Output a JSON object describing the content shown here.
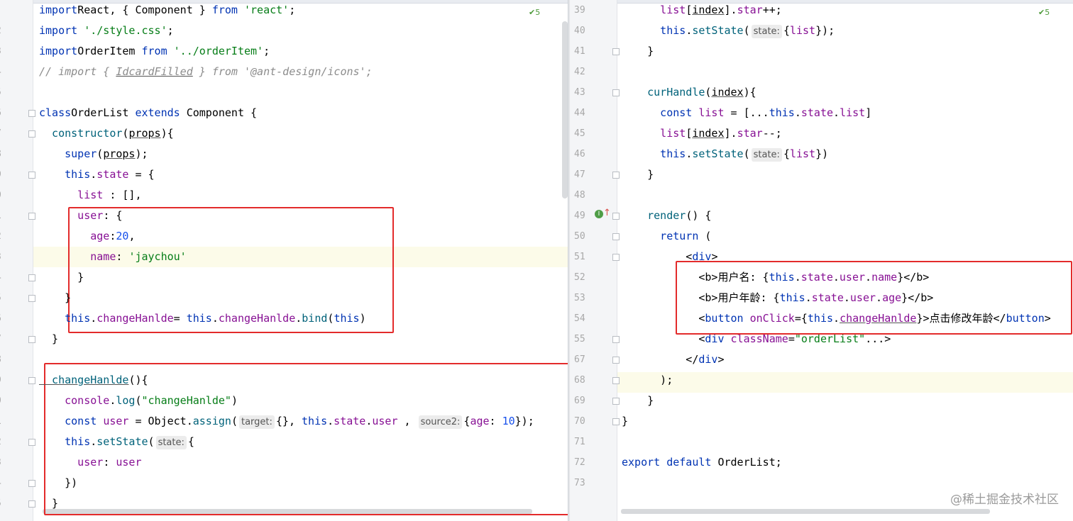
{
  "left_editor": {
    "inspection_badge": "5",
    "line_numbers": [
      "",
      "2",
      "3",
      "4",
      "5",
      "6",
      "7",
      "8",
      "9",
      "0",
      "1",
      "2",
      "3",
      "4",
      "5",
      "6",
      "7",
      "8",
      "9",
      "0",
      "1",
      "2",
      "3",
      "4",
      "5"
    ],
    "lines": [
      [
        [
          "kw",
          "import"
        ],
        [
          "",
          "React, { Component } "
        ],
        [
          "kw",
          "from"
        ],
        [
          "str",
          " 'react'"
        ],
        [
          "",
          ";"
        ]
      ],
      [
        [
          "kw",
          "import"
        ],
        [
          "str",
          " './style.css'"
        ],
        [
          "",
          ";"
        ]
      ],
      [
        [
          "kw",
          "import"
        ],
        [
          "",
          "OrderItem "
        ],
        [
          "kw",
          "from"
        ],
        [
          "str",
          " '../orderItem'"
        ],
        [
          "",
          ";"
        ]
      ],
      [
        [
          "cmt",
          "// import { "
        ],
        [
          "cmt-u",
          "IdcardFilled"
        ],
        [
          "cmt",
          " } from '@ant-design/icons';"
        ]
      ],
      [],
      [
        [
          "kw",
          "class"
        ],
        [
          "",
          "OrderList "
        ],
        [
          "kw",
          "extends"
        ],
        [
          "",
          " Component {"
        ]
      ],
      [
        [
          "",
          ""
        ],
        [
          "fn",
          "  constructor"
        ],
        [
          "",
          "("
        ],
        [
          "u",
          "props"
        ],
        [
          "",
          "){"
        ]
      ],
      [
        [
          "kw",
          "    super"
        ],
        [
          "",
          "("
        ],
        [
          "u",
          "props"
        ],
        [
          "",
          ");"
        ]
      ],
      [
        [
          "kw",
          "    this"
        ],
        [
          "",
          "."
        ],
        [
          "prop",
          "state"
        ],
        [
          "",
          " = {"
        ]
      ],
      [
        [
          "prop",
          "      list"
        ],
        [
          "",
          " : [],"
        ]
      ],
      [
        [
          "prop",
          "      user"
        ],
        [
          "",
          ": {"
        ]
      ],
      [
        [
          "prop",
          "        age"
        ],
        [
          "",
          ":"
        ],
        [
          "num",
          "20"
        ],
        [
          "",
          ","
        ]
      ],
      [
        [
          "prop",
          "        name"
        ],
        [
          "",
          ": "
        ],
        [
          "str",
          "'jaychou'"
        ]
      ],
      [
        [
          "",
          "      }"
        ]
      ],
      [
        [
          "",
          "    }"
        ]
      ],
      [
        [
          "kw",
          "    this"
        ],
        [
          "",
          "."
        ],
        [
          "prop",
          "changeHanlde"
        ],
        [
          "",
          "= "
        ],
        [
          "kw",
          "this"
        ],
        [
          "",
          "."
        ],
        [
          "prop",
          "changeHanlde"
        ],
        [
          "",
          "."
        ],
        [
          "fn",
          "bind"
        ],
        [
          "",
          "("
        ],
        [
          "kw",
          "this"
        ],
        [
          "",
          ")"
        ]
      ],
      [
        [
          "",
          "  }"
        ]
      ],
      [],
      [
        [
          "fn-u",
          "  changeHanlde"
        ],
        [
          "",
          "(){"
        ]
      ],
      [
        [
          "prop",
          "    console"
        ],
        [
          "",
          "."
        ],
        [
          "fn",
          "log"
        ],
        [
          "",
          "("
        ],
        [
          "str",
          "\"changeHanlde\""
        ],
        [
          "",
          ")"
        ]
      ],
      [
        [
          "kw",
          "    const "
        ],
        [
          "prop",
          "user"
        ],
        [
          "",
          " = "
        ],
        [
          "",
          "Object."
        ],
        [
          "fn",
          "assign"
        ],
        [
          "",
          "("
        ],
        [
          "hint",
          "target:"
        ],
        [
          "",
          "{}, "
        ],
        [
          "kw",
          "this"
        ],
        [
          "",
          "."
        ],
        [
          "prop",
          "state"
        ],
        [
          "",
          "."
        ],
        [
          "prop",
          "user"
        ],
        [
          "",
          " , "
        ],
        [
          "hint",
          "source2:"
        ],
        [
          "",
          "{"
        ],
        [
          "prop",
          "age"
        ],
        [
          "",
          ": "
        ],
        [
          "num",
          "10"
        ],
        [
          "",
          "});"
        ]
      ],
      [
        [
          "kw",
          "    this"
        ],
        [
          "",
          "."
        ],
        [
          "fn",
          "setState"
        ],
        [
          "",
          "("
        ],
        [
          "hint",
          "state:"
        ],
        [
          "",
          "{"
        ]
      ],
      [
        [
          "prop",
          "      user"
        ],
        [
          "",
          ": "
        ],
        [
          "prop",
          "user"
        ]
      ],
      [
        [
          "",
          "    })"
        ]
      ],
      [
        [
          "",
          "  }"
        ]
      ]
    ]
  },
  "right_editor": {
    "inspection_badge": "5",
    "line_numbers": [
      "39",
      "40",
      "41",
      "42",
      "43",
      "44",
      "45",
      "46",
      "47",
      "48",
      "49",
      "50",
      "51",
      "52",
      "53",
      "54",
      "55",
      "67",
      "68",
      "69",
      "70",
      "71",
      "72",
      "73"
    ],
    "lines": [
      [
        [
          "prop",
          "      list"
        ],
        [
          "",
          "["
        ],
        [
          "u",
          "index"
        ],
        [
          "",
          "]."
        ],
        [
          "prop",
          "star"
        ],
        [
          "",
          "++;"
        ]
      ],
      [
        [
          "kw",
          "      this"
        ],
        [
          "",
          "."
        ],
        [
          "fn",
          "setState"
        ],
        [
          "",
          "("
        ],
        [
          "hint",
          "state:"
        ],
        [
          "",
          "{"
        ],
        [
          "prop",
          "list"
        ],
        [
          "",
          "});"
        ]
      ],
      [
        [
          "",
          "    }"
        ]
      ],
      [],
      [
        [
          "fn",
          "    curHandle"
        ],
        [
          "",
          "("
        ],
        [
          "u",
          "index"
        ],
        [
          "",
          "){"
        ]
      ],
      [
        [
          "kw",
          "      const "
        ],
        [
          "prop",
          "list"
        ],
        [
          "",
          " = [..."
        ],
        [
          "kw",
          "this"
        ],
        [
          "",
          "."
        ],
        [
          "prop",
          "state"
        ],
        [
          "",
          "."
        ],
        [
          "prop",
          "list"
        ],
        [
          "",
          "]"
        ]
      ],
      [
        [
          "prop",
          "      list"
        ],
        [
          "",
          "["
        ],
        [
          "u",
          "index"
        ],
        [
          "",
          "]."
        ],
        [
          "prop",
          "star"
        ],
        [
          "",
          "--;"
        ]
      ],
      [
        [
          "kw",
          "      this"
        ],
        [
          "",
          "."
        ],
        [
          "fn",
          "setState"
        ],
        [
          "",
          "("
        ],
        [
          "hint",
          "state:"
        ],
        [
          "",
          "{"
        ],
        [
          "prop",
          "list"
        ],
        [
          "",
          "})"
        ]
      ],
      [
        [
          "",
          "    }"
        ]
      ],
      [],
      [
        [
          "fn",
          "    render"
        ],
        [
          "",
          "() {"
        ]
      ],
      [
        [
          "kw",
          "      return"
        ],
        [
          "",
          " ("
        ]
      ],
      [
        [
          "",
          "          <"
        ],
        [
          "kw-u",
          "div"
        ],
        [
          "",
          ">"
        ]
      ],
      [
        [
          "",
          "            <b>用户名: {"
        ],
        [
          "kw",
          "this"
        ],
        [
          "",
          "."
        ],
        [
          "prop",
          "state"
        ],
        [
          "",
          "."
        ],
        [
          "prop",
          "user"
        ],
        [
          "",
          "."
        ],
        [
          "prop",
          "name"
        ],
        [
          "",
          "}</b>"
        ]
      ],
      [
        [
          "",
          "            <b>用户年龄: {"
        ],
        [
          "kw",
          "this"
        ],
        [
          "",
          "."
        ],
        [
          "prop",
          "state"
        ],
        [
          "",
          "."
        ],
        [
          "prop",
          "user"
        ],
        [
          "",
          "."
        ],
        [
          "prop",
          "age"
        ],
        [
          "",
          "}</b>"
        ]
      ],
      [
        [
          "",
          "            <"
        ],
        [
          "kw",
          "button "
        ],
        [
          "prop",
          "onClick"
        ],
        [
          "",
          "={"
        ],
        [
          "kw",
          "this"
        ],
        [
          "",
          "."
        ],
        [
          "prop-u",
          "changeHanlde"
        ],
        [
          "",
          "}>点击修改年龄</"
        ],
        [
          "kw",
          "button"
        ],
        [
          "",
          ">"
        ]
      ],
      [
        [
          "",
          "            <"
        ],
        [
          "kw",
          "div "
        ],
        [
          "prop",
          "className"
        ],
        [
          "",
          "="
        ],
        [
          "str",
          "\"orderList\""
        ],
        [
          "",
          "...>"
        ]
      ],
      [
        [
          "",
          "          </"
        ],
        [
          "kw",
          "div"
        ],
        [
          "",
          ">"
        ]
      ],
      [
        [
          "",
          "      );"
        ]
      ],
      [
        [
          "",
          "    }"
        ]
      ],
      [
        [
          "",
          "}"
        ]
      ],
      [],
      [
        [
          "kw",
          "export default "
        ],
        [
          "",
          "OrderList;"
        ]
      ],
      []
    ]
  },
  "watermark": "@稀土掘金技术社区",
  "colors": {
    "red_box": "#e32b2b",
    "keyword": "#0033b3",
    "string": "#067d17",
    "property": "#871094",
    "number": "#1750eb",
    "comment": "#8c8c8c",
    "function": "#00627a"
  }
}
